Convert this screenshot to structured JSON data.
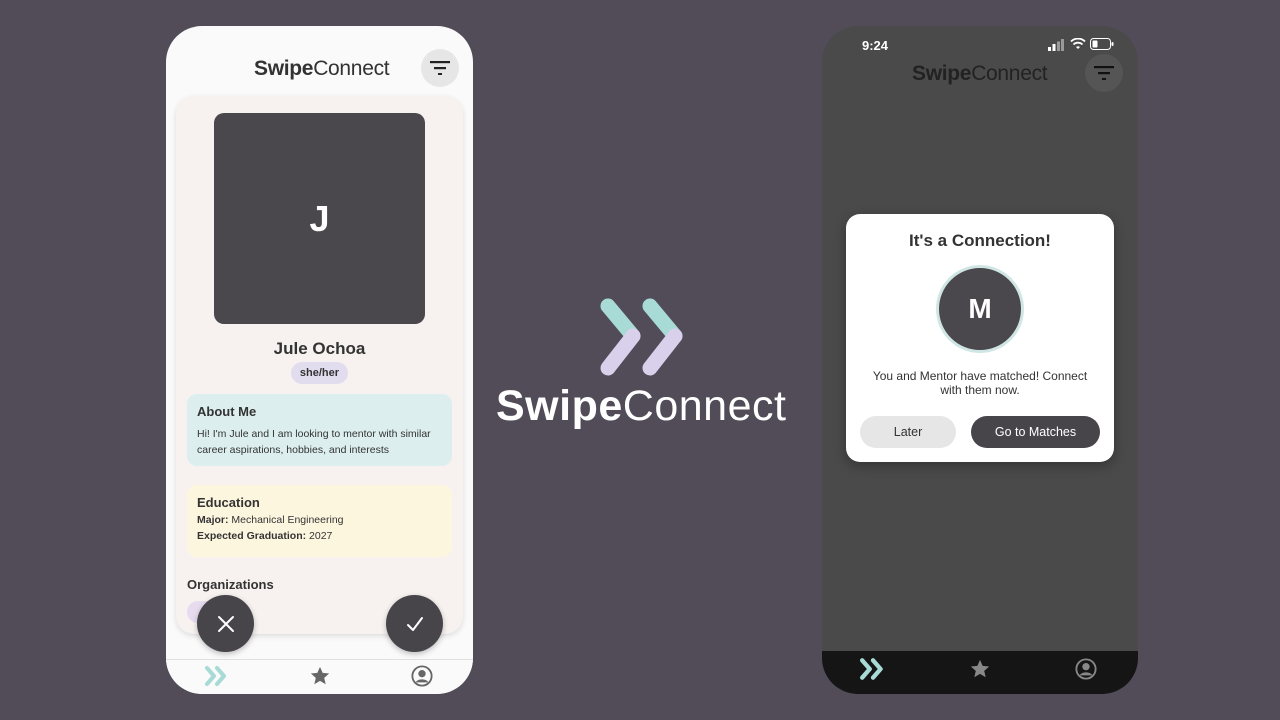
{
  "app": {
    "brand_bold": "Swipe",
    "brand_light": "Connect"
  },
  "left_phone": {
    "profile": {
      "initial": "J",
      "name": "Jule Ochoa",
      "pronouns": "she/her",
      "about_title": "About Me",
      "about_text": "Hi! I'm Jule and I am looking to mentor with similar career aspirations, hobbies, and interests",
      "education_title": "Education",
      "major_label": "Major:",
      "major_value": "Mechanical Engineering",
      "grad_label": "Expected Graduation:",
      "grad_value": "2027",
      "organizations_title": "Organizations"
    },
    "tabs": [
      "swipe",
      "favorites",
      "profile"
    ]
  },
  "center_logo": {
    "text_bold": "Swipe",
    "text_light": "Connect"
  },
  "right_phone": {
    "status_time": "9:24",
    "modal": {
      "title": "It's a Connection!",
      "initial": "M",
      "message": "You and Mentor have matched! Connect with them now.",
      "later_label": "Later",
      "matches_label": "Go to Matches"
    }
  },
  "colors": {
    "background": "#524c59",
    "accent_teal": "#a9dbd6",
    "accent_lavender": "#d9d0ec",
    "dark_button": "#47454a"
  },
  "icons": [
    "filter-icon",
    "close-icon",
    "check-icon",
    "swipe-chevrons-icon",
    "star-icon",
    "user-circle-icon",
    "signal-icon",
    "wifi-icon",
    "battery-icon"
  ]
}
